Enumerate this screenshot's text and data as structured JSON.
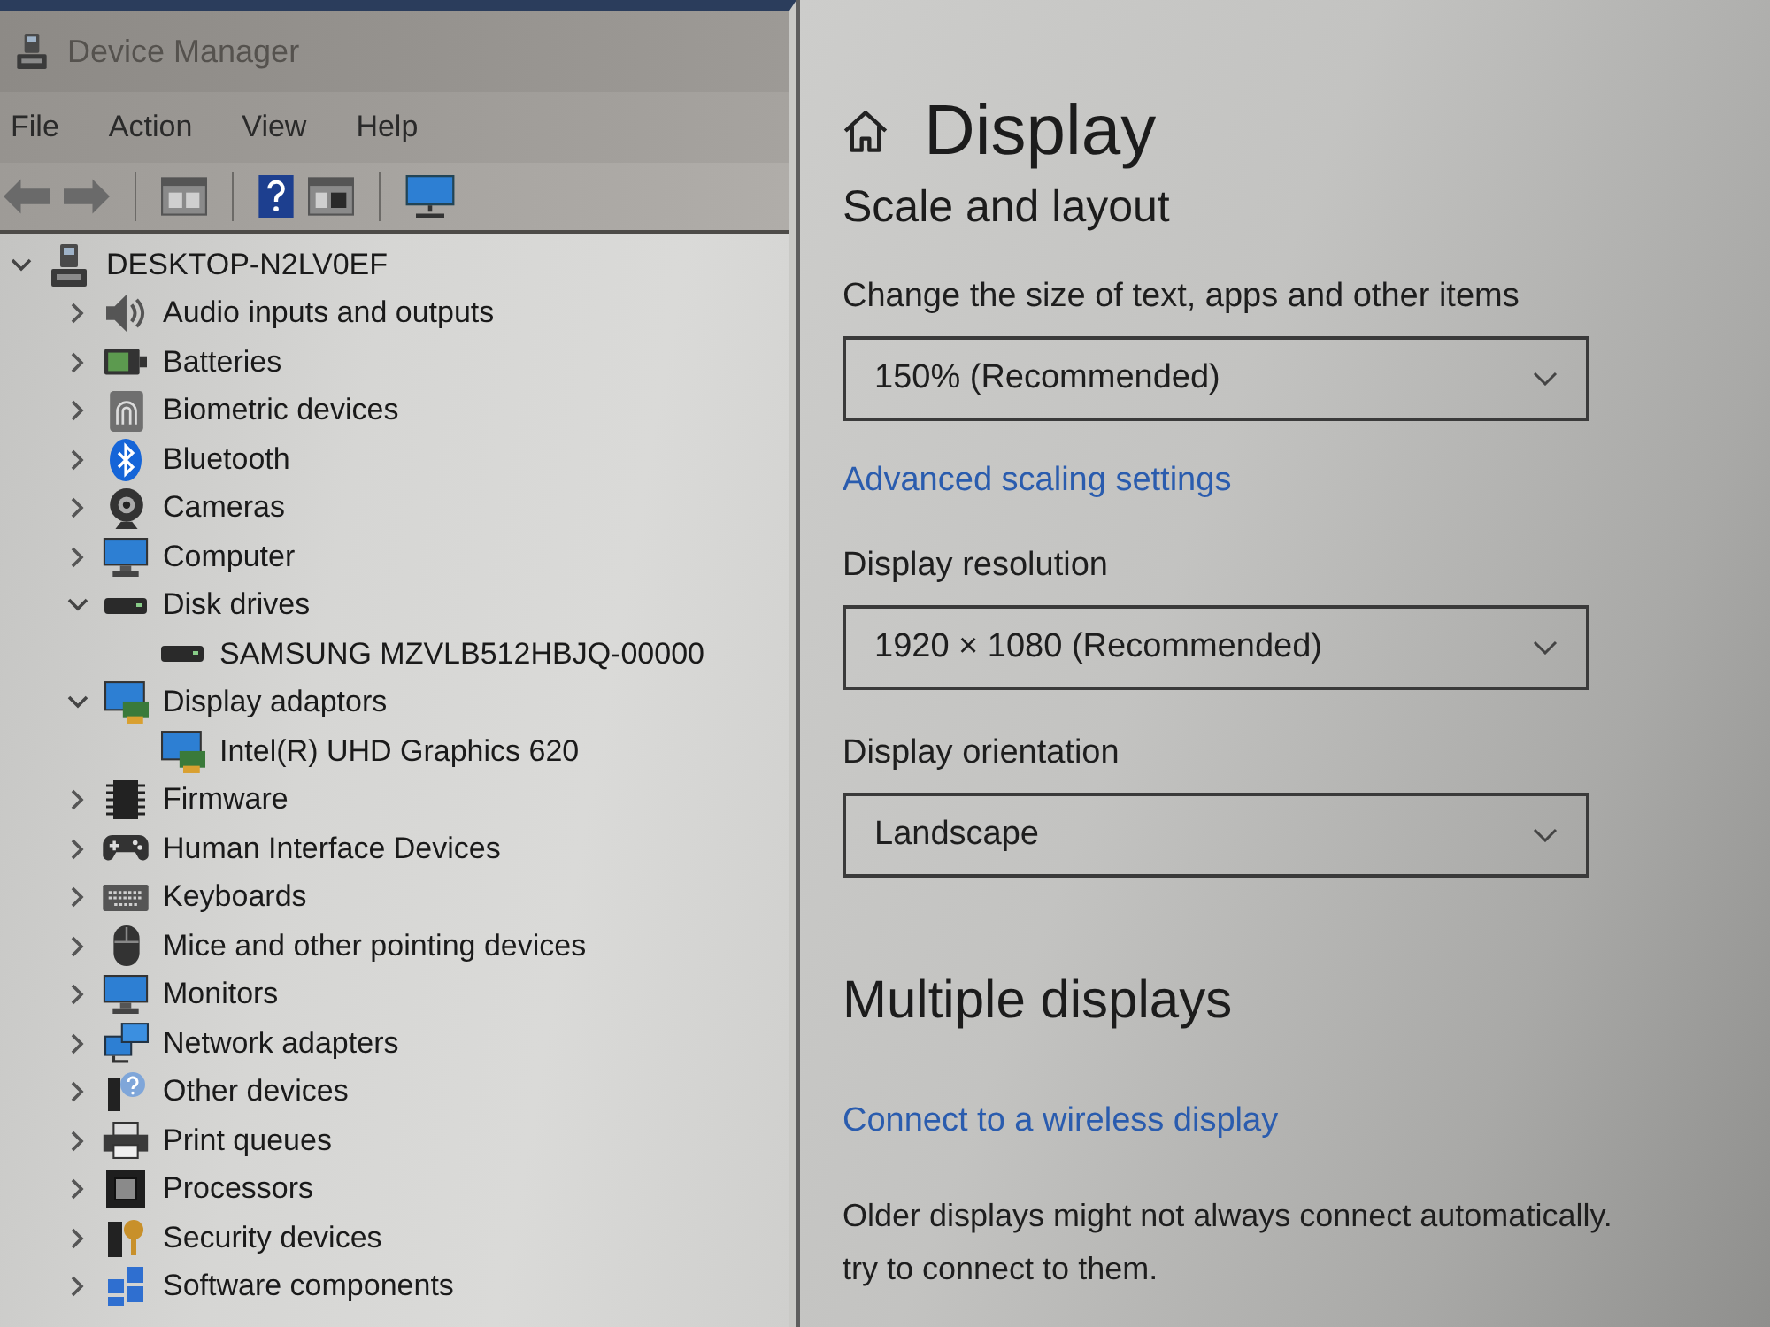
{
  "device_manager": {
    "title": "Device Manager",
    "menu": [
      "File",
      "Action",
      "View",
      "Help"
    ],
    "tree": {
      "label": "DESKTOP-N2LV0EF",
      "expanded": true,
      "children": [
        {
          "label": "Audio inputs and outputs",
          "expanded": false
        },
        {
          "label": "Batteries",
          "expanded": false
        },
        {
          "label": "Biometric devices",
          "expanded": false
        },
        {
          "label": "Bluetooth",
          "expanded": false
        },
        {
          "label": "Cameras",
          "expanded": false
        },
        {
          "label": "Computer",
          "expanded": false
        },
        {
          "label": "Disk drives",
          "expanded": true,
          "children": [
            {
              "label": "SAMSUNG MZVLB512HBJQ-00000"
            }
          ]
        },
        {
          "label": "Display adaptors",
          "expanded": true,
          "children": [
            {
              "label": "Intel(R) UHD Graphics 620"
            }
          ]
        },
        {
          "label": "Firmware",
          "expanded": false
        },
        {
          "label": "Human Interface Devices",
          "expanded": false
        },
        {
          "label": "Keyboards",
          "expanded": false
        },
        {
          "label": "Mice and other pointing devices",
          "expanded": false
        },
        {
          "label": "Monitors",
          "expanded": false
        },
        {
          "label": "Network adapters",
          "expanded": false
        },
        {
          "label": "Other devices",
          "expanded": false
        },
        {
          "label": "Print queues",
          "expanded": false
        },
        {
          "label": "Processors",
          "expanded": false
        },
        {
          "label": "Security devices",
          "expanded": false
        },
        {
          "label": "Software components",
          "expanded": false
        }
      ]
    }
  },
  "settings": {
    "title": "Display",
    "sections": [
      {
        "heading": "Scale and layout",
        "items": [
          {
            "kind": "dropdown",
            "label": "Change the size of text, apps and other items",
            "value": "150% (Recommended)"
          },
          {
            "kind": "link",
            "text": "Advanced scaling settings"
          },
          {
            "kind": "dropdown",
            "label": "Display resolution",
            "value": "1920 × 1080 (Recommended)"
          },
          {
            "kind": "dropdown",
            "label": "Display orientation",
            "value": "Landscape"
          }
        ]
      },
      {
        "heading": "Multiple displays",
        "items": [
          {
            "kind": "link",
            "text": "Connect to a wireless display"
          },
          {
            "kind": "paragraph",
            "text": "Older displays might not always connect automatically.\ntry to connect to them."
          }
        ]
      }
    ]
  }
}
